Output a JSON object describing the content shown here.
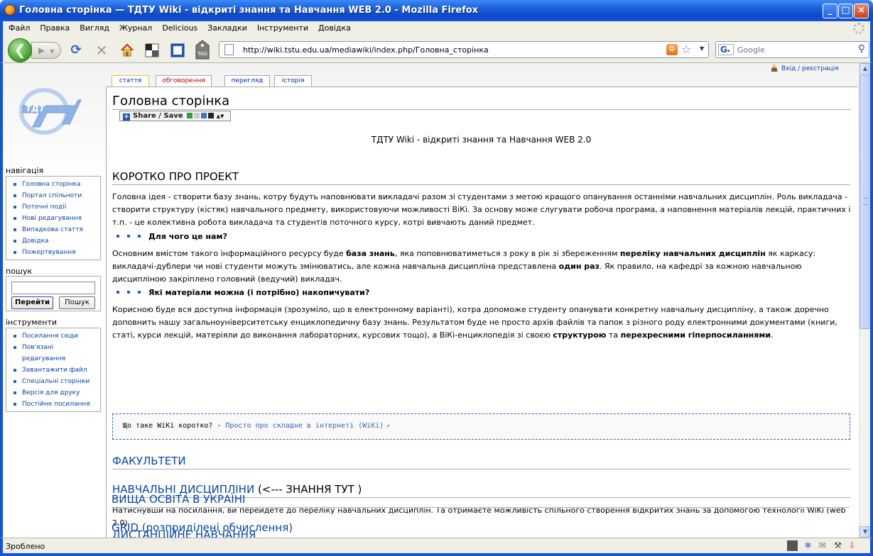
{
  "window": {
    "title": "Головна сторінка — ТДТУ Wiki - відкриті знання та Навчання WEB 2.0 - Mozilla Firefox",
    "minimize": "_",
    "maximize": "□",
    "close": "×"
  },
  "menu": [
    "Файл",
    "Правка",
    "Вигляд",
    "Журнал",
    "Delicious",
    "Закладки",
    "Інструменти",
    "Довідка"
  ],
  "toolbar": {
    "url": "http://wiki.tstu.edu.ua/mediawiki/index.php/Головна_сторінка",
    "search_placeholder": "Google",
    "tag_label": "TAG"
  },
  "status": {
    "text": "Зроблено"
  },
  "wiki": {
    "user_link": "Вхід / реєстрація",
    "tabs": [
      "стаття",
      "обговорення",
      "перегляд",
      "історія"
    ],
    "nav_heading": "навігація",
    "nav_items": [
      "Головна сторінка",
      "Портал спільноти",
      "Поточні події",
      "Нові редагування",
      "Випадкова стаття",
      "Довідка",
      "Пожертвування"
    ],
    "search_heading": "пошук",
    "search_go": "Перейти",
    "search_btn": "Пошук",
    "tools_heading": "інструменти",
    "tools_items": [
      "Посилання сюди",
      "Пов'язані",
      "редагування",
      "Завантажити файл",
      "Спеціальні сторінки",
      "Версія для друку",
      "Постійне посилання"
    ],
    "page_title": "Головна сторінка",
    "share": "Share / Save",
    "subtitle": "ТДТУ Wiki - відкриті знання та Навчання WEB 2.0",
    "h_project": "КОРОТКО ПРО ПРОЕКТ",
    "p1": "Головна ідея - створити базу знань, котру будуть наповнювати викладачі разом зі студентами з метою кращого опанування останніми навчальних дисциплін. Роль викладача - створити структуру (кістяк) навчального предмету, використовуючи можливості ВіКі. За основу може слугувати робоча програма, а наповнення матеріалів лекцій, практичних і т.п. - це колективна робота викладача та студентів поточного курсу, котрі вивчають даний предмет.",
    "q1": "Для чого це нам?",
    "p2_a": "Основним вмістом такого інформаційного ресурсу буде ",
    "p2_b": "база знань",
    "p2_c": ", яка поповнюватиметься з року в рік зі збереженням ",
    "p2_d": "переліку навчальних дисциплін",
    "p2_e": " як каркасу: викладачі-дублери чи нові студенти можуть змінюватись, але кожна навчальна дисципліна представлена ",
    "p2_f": "один раз",
    "p2_g": ". Як правило, на кафедрі за кожною навчальною дисципліною закріплено головний (ведучий) викладач.",
    "q2": "Які матеріали можна (і потрібно) накопичувати?",
    "p3_a": "Корисною буде вся доступна інформація (зрозуміло, що в електронному варіанті), котра допоможе студенту опанувати конкретну навчальну дисципліну, а також доречно доповнить нашу загальноуніверситетську енциклопедичну базу знань. Результатом буде не просто архів файлів та папок з різного роду електронними документами (книги, статі, курси лекцій, матеріяли до виконання лабораторних, курсових тощо), а ВіКі-енциклопедія зі своєю ",
    "p3_b": "структурою",
    "p3_c": " та ",
    "p3_d": "перехресними гіперпосиланнями",
    "p3_e": ".",
    "pre_text": "Що таке WiKi коротко? - ",
    "pre_link": "Просто про складне в інтернеті (WiKi)",
    "h_faculties": "ФАКУЛЬТЕТИ",
    "h_courses": "НАВЧАЛЬНІ ДИСЦИПЛІНИ",
    "h_courses_suffix": " (<--- ЗНАННЯ ТУТ )",
    "p4": "Натиснувши на посилання, ви перейдете до переліку навчальних дисциплін. Та отримаєте можливість спільного створення відкритих знань за допомогою технології WiKi (web 2.0).",
    "h_distance": "ДИСТАНЦІЙНЕ НАВЧАННЯ",
    "h_higher": "ВИЩА ОСВІТА В УКРАЇНІ",
    "h_grid": "GRID",
    "h_grid_suffix": " (розприділені обчислення)"
  },
  "colors": {
    "link": "#0645ad",
    "titlebar": "#1452d6",
    "tab_selected": "#fabd23"
  },
  "icons": [
    "firefox-icon",
    "back-arrow-icon",
    "forward-arrow-icon",
    "reload-icon",
    "stop-icon",
    "home-icon",
    "rss-icon",
    "star-icon",
    "magnifier-icon",
    "user-icon",
    "external-link-icon"
  ]
}
